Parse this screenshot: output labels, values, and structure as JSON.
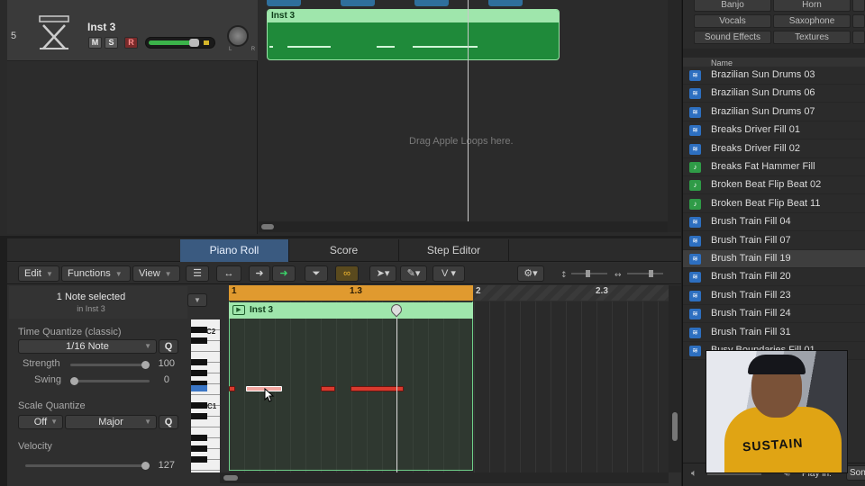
{
  "track": {
    "number": "5",
    "name": "Inst 3",
    "mute": "M",
    "solo": "S",
    "record": "R",
    "pan_labels": "L R"
  },
  "arrange": {
    "region_name": "Inst 3",
    "drop_hint": "Drag Apple Loops here."
  },
  "editor": {
    "tabs": [
      "Piano Roll",
      "Score",
      "Step Editor"
    ],
    "active_tab": "Piano Roll",
    "menus": {
      "edit": "Edit",
      "functions": "Functions",
      "view": "View"
    },
    "catch_mode_color": "#3bd36a",
    "link_mode_color": "#f2b830"
  },
  "inspector": {
    "selection_title": "1 Note selected",
    "selection_sub": "in Inst 3",
    "time_quantize_label": "Time Quantize (classic)",
    "time_quantize_value": "1/16 Note",
    "q_label": "Q",
    "strength_label": "Strength",
    "strength_value": "100",
    "strength_level": 1.0,
    "swing_label": "Swing",
    "swing_value": "0",
    "swing_level": 0.0,
    "scale_quantize_label": "Scale Quantize",
    "scale_root": "Off",
    "scale_type": "Major",
    "velocity_label": "Velocity",
    "velocity_value": "127",
    "velocity_level": 1.0
  },
  "piano_roll": {
    "ruler_labels": [
      "1",
      "1.3",
      "2",
      "2.3"
    ],
    "region_name": "Inst 3",
    "key_labels": [
      "C2",
      "C1"
    ]
  },
  "browser": {
    "categories": [
      [
        "Banjo",
        "Horn"
      ],
      [
        "Vocals",
        "Saxophone"
      ],
      [
        "Sound Effects",
        "Textures"
      ]
    ],
    "column_name": "Name",
    "loops": [
      {
        "name": "Brazilian Sun Drums 03",
        "kind": "audio"
      },
      {
        "name": "Brazilian Sun Drums 06",
        "kind": "audio"
      },
      {
        "name": "Brazilian Sun Drums 07",
        "kind": "audio"
      },
      {
        "name": "Breaks Driver Fill 01",
        "kind": "audio"
      },
      {
        "name": "Breaks Driver Fill 02",
        "kind": "audio"
      },
      {
        "name": "Breaks Fat Hammer Fill",
        "kind": "midi"
      },
      {
        "name": "Broken Beat Flip Beat 02",
        "kind": "midi"
      },
      {
        "name": "Broken Beat Flip Beat 11",
        "kind": "midi"
      },
      {
        "name": "Brush Train Fill 04",
        "kind": "audio"
      },
      {
        "name": "Brush Train Fill 07",
        "kind": "audio"
      },
      {
        "name": "Brush Train Fill 19",
        "kind": "audio",
        "selected": true
      },
      {
        "name": "Brush Train Fill 20",
        "kind": "audio"
      },
      {
        "name": "Brush Train Fill 23",
        "kind": "audio"
      },
      {
        "name": "Brush Train Fill 24",
        "kind": "audio"
      },
      {
        "name": "Brush Train Fill 31",
        "kind": "audio"
      },
      {
        "name": "Busy Boundaries Fill 01",
        "kind": "audio"
      }
    ],
    "play_in_label": "Play in:",
    "play_in_value": "Son"
  },
  "webcam": {
    "shirt_text": "SUSTAIN"
  }
}
